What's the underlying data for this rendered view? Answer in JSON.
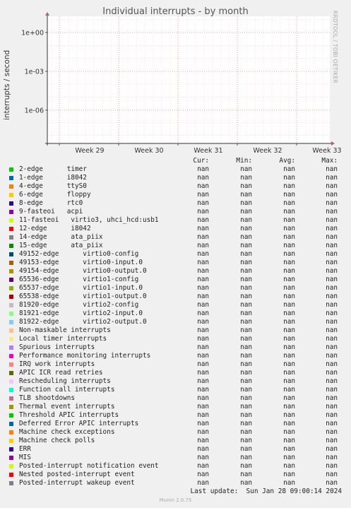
{
  "chart_data": {
    "type": "line",
    "title": "Individual interrupts - by month",
    "ylabel": "interrupts / second",
    "yscale": "log",
    "y_ticks": [
      "1e+00",
      "1e-03",
      "1e-06"
    ],
    "x_ticks": [
      "Week 29",
      "Week 30",
      "Week 31",
      "Week 32",
      "Week 33"
    ],
    "grid": true,
    "series_values": "nan"
  },
  "watermark": "RRDTOOL / TOBI OETIKER",
  "columns": {
    "cur": "Cur:",
    "min": "Min:",
    "avg": "Avg:",
    "max": "Max:"
  },
  "legend": [
    {
      "label": "2-edge      timer",
      "color": "#00cc00",
      "cur": "nan",
      "min": "nan",
      "avg": "nan",
      "max": "nan"
    },
    {
      "label": "1-edge      i8042",
      "color": "#0066b3",
      "cur": "nan",
      "min": "nan",
      "avg": "nan",
      "max": "nan"
    },
    {
      "label": "4-edge      ttyS0",
      "color": "#ff8000",
      "cur": "nan",
      "min": "nan",
      "avg": "nan",
      "max": "nan"
    },
    {
      "label": "6-edge      floppy",
      "color": "#ffcc00",
      "cur": "nan",
      "min": "nan",
      "avg": "nan",
      "max": "nan"
    },
    {
      "label": "8-edge      rtc0",
      "color": "#330099",
      "cur": "nan",
      "min": "nan",
      "avg": "nan",
      "max": "nan"
    },
    {
      "label": "9-fasteoi   acpi",
      "color": "#990099",
      "cur": "nan",
      "min": "nan",
      "avg": "nan",
      "max": "nan"
    },
    {
      "label": "11-fasteoi   virtio3, uhci_hcd:usb1",
      "color": "#ccff00",
      "cur": "nan",
      "min": "nan",
      "avg": "nan",
      "max": "nan"
    },
    {
      "label": "12-edge      i8042",
      "color": "#ff0000",
      "cur": "nan",
      "min": "nan",
      "avg": "nan",
      "max": "nan"
    },
    {
      "label": "14-edge      ata_piix",
      "color": "#808080",
      "cur": "nan",
      "min": "nan",
      "avg": "nan",
      "max": "nan"
    },
    {
      "label": "15-edge      ata_piix",
      "color": "#008f00",
      "cur": "nan",
      "min": "nan",
      "avg": "nan",
      "max": "nan"
    },
    {
      "label": "49152-edge      virtio0-config",
      "color": "#00487d",
      "cur": "nan",
      "min": "nan",
      "avg": "nan",
      "max": "nan"
    },
    {
      "label": "49153-edge      virtio0-input.0",
      "color": "#b35a00",
      "cur": "nan",
      "min": "nan",
      "avg": "nan",
      "max": "nan"
    },
    {
      "label": "49154-edge      virtio0-output.0",
      "color": "#b38f00",
      "cur": "nan",
      "min": "nan",
      "avg": "nan",
      "max": "nan"
    },
    {
      "label": "65536-edge      virtio1-config",
      "color": "#6b006b",
      "cur": "nan",
      "min": "nan",
      "avg": "nan",
      "max": "nan"
    },
    {
      "label": "65537-edge      virtio1-input.0",
      "color": "#8fb300",
      "cur": "nan",
      "min": "nan",
      "avg": "nan",
      "max": "nan"
    },
    {
      "label": "65538-edge      virtio1-output.0",
      "color": "#b30000",
      "cur": "nan",
      "min": "nan",
      "avg": "nan",
      "max": "nan"
    },
    {
      "label": "81920-edge      virtio2-config",
      "color": "#bebebe",
      "cur": "nan",
      "min": "nan",
      "avg": "nan",
      "max": "nan"
    },
    {
      "label": "81921-edge      virtio2-input.0",
      "color": "#80ff80",
      "cur": "nan",
      "min": "nan",
      "avg": "nan",
      "max": "nan"
    },
    {
      "label": "81922-edge      virtio2-output.0",
      "color": "#80c9ff",
      "cur": "nan",
      "min": "nan",
      "avg": "nan",
      "max": "nan"
    },
    {
      "label": "Non-maskable interrupts",
      "color": "#ffc080",
      "cur": "nan",
      "min": "nan",
      "avg": "nan",
      "max": "nan"
    },
    {
      "label": "Local timer interrupts",
      "color": "#ffe680",
      "cur": "nan",
      "min": "nan",
      "avg": "nan",
      "max": "nan"
    },
    {
      "label": "Spurious interrupts",
      "color": "#aa80ff",
      "cur": "nan",
      "min": "nan",
      "avg": "nan",
      "max": "nan"
    },
    {
      "label": "Performance monitoring interrupts",
      "color": "#ee00cc",
      "cur": "nan",
      "min": "nan",
      "avg": "nan",
      "max": "nan"
    },
    {
      "label": "IRQ work interrupts",
      "color": "#ff8080",
      "cur": "nan",
      "min": "nan",
      "avg": "nan",
      "max": "nan"
    },
    {
      "label": "APIC ICR read retries",
      "color": "#666600",
      "cur": "nan",
      "min": "nan",
      "avg": "nan",
      "max": "nan"
    },
    {
      "label": "Rescheduling interrupts",
      "color": "#ffbfff",
      "cur": "nan",
      "min": "nan",
      "avg": "nan",
      "max": "nan"
    },
    {
      "label": "Function call interrupts",
      "color": "#00ffcc",
      "cur": "nan",
      "min": "nan",
      "avg": "nan",
      "max": "nan"
    },
    {
      "label": "TLB shootdowns",
      "color": "#cc6699",
      "cur": "nan",
      "min": "nan",
      "avg": "nan",
      "max": "nan"
    },
    {
      "label": "Thermal event interrupts",
      "color": "#999900",
      "cur": "nan",
      "min": "nan",
      "avg": "nan",
      "max": "nan"
    },
    {
      "label": "Threshold APIC interrupts",
      "color": "#00cc00",
      "cur": "nan",
      "min": "nan",
      "avg": "nan",
      "max": "nan"
    },
    {
      "label": "Deferred Error APIC interrupts",
      "color": "#0066b3",
      "cur": "nan",
      "min": "nan",
      "avg": "nan",
      "max": "nan"
    },
    {
      "label": "Machine check exceptions",
      "color": "#ff8000",
      "cur": "nan",
      "min": "nan",
      "avg": "nan",
      "max": "nan"
    },
    {
      "label": "Machine check polls",
      "color": "#ffcc00",
      "cur": "nan",
      "min": "nan",
      "avg": "nan",
      "max": "nan"
    },
    {
      "label": "ERR",
      "color": "#330099",
      "cur": "nan",
      "min": "nan",
      "avg": "nan",
      "max": "nan"
    },
    {
      "label": "MIS",
      "color": "#990099",
      "cur": "nan",
      "min": "nan",
      "avg": "nan",
      "max": "nan"
    },
    {
      "label": "Posted-interrupt notification event",
      "color": "#ccff00",
      "cur": "nan",
      "min": "nan",
      "avg": "nan",
      "max": "nan"
    },
    {
      "label": "Nested posted-interrupt event",
      "color": "#ff0000",
      "cur": "nan",
      "min": "nan",
      "avg": "nan",
      "max": "nan"
    },
    {
      "label": "Posted-interrupt wakeup event",
      "color": "#808080",
      "cur": "nan",
      "min": "nan",
      "avg": "nan",
      "max": "nan"
    }
  ],
  "last_update": "Last update:  Sun Jan 28 09:00:14 2024",
  "footer": "Munin 2.0.75"
}
